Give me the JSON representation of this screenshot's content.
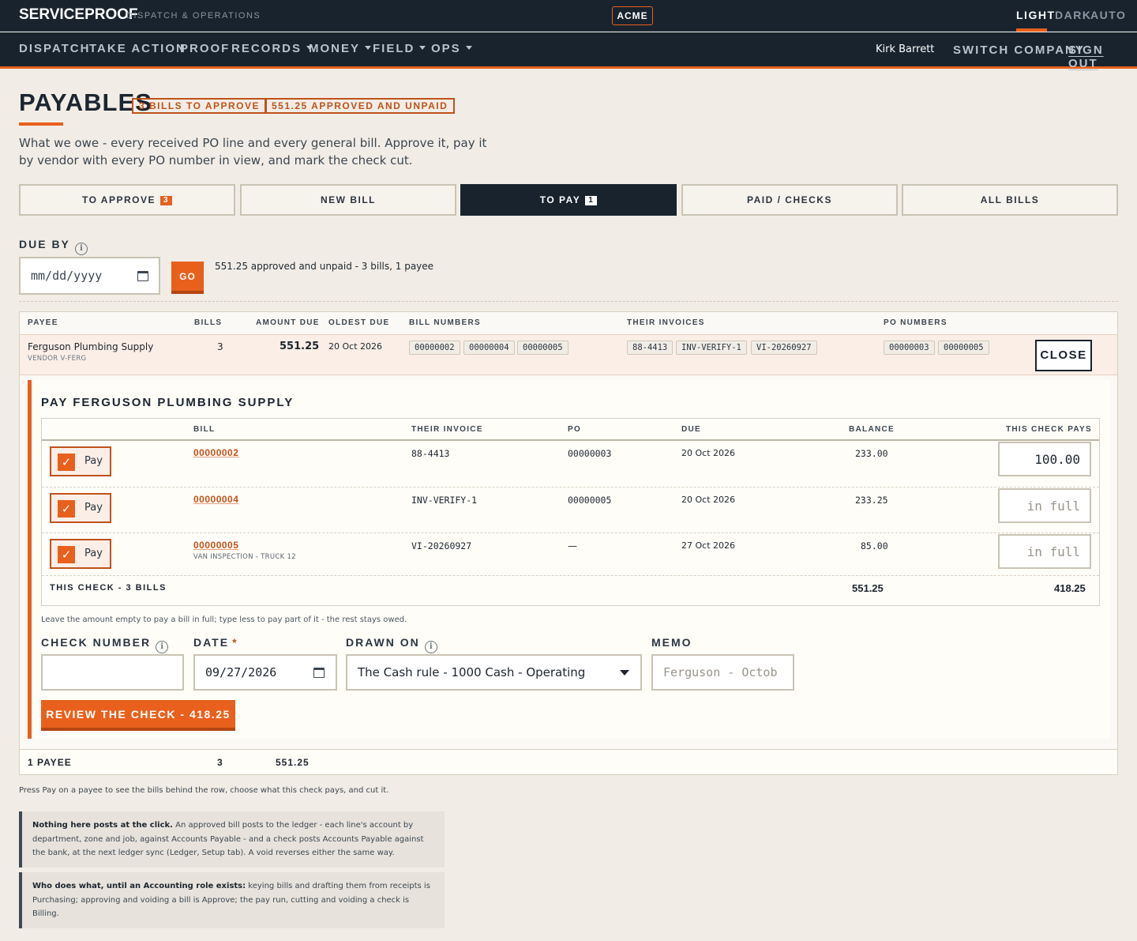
{
  "app": {
    "brand": "SERVICEPROOF",
    "brand_sub": "DISPATCH & OPERATIONS",
    "company_badge": "ACME",
    "theme": {
      "light": "LIGHT",
      "dark": "DARK",
      "auto": "AUTO",
      "selected": "LIGHT"
    }
  },
  "nav": {
    "items": [
      {
        "label": "DISPATCH"
      },
      {
        "label": "TAKE ACTION"
      },
      {
        "label": "PROOF"
      },
      {
        "label": "RECORDS"
      },
      {
        "label": "MONEY"
      },
      {
        "label": "FIELD"
      },
      {
        "label": "OPS"
      }
    ],
    "user": "Kirk Barrett",
    "switch_company": "SWITCH COMPANY",
    "sign_out": "SIGN OUT"
  },
  "page": {
    "title": "PAYABLES",
    "pill_approve": "3 BILLS TO APPROVE",
    "pill_unpaid": "551.25 APPROVED AND UNPAID",
    "lede": "What we owe - every received PO line and every general bill. Approve it, pay it by vendor with every PO number in view, and mark the check cut."
  },
  "tabs": [
    {
      "label": "TO APPROVE",
      "count": "3"
    },
    {
      "label": "NEW BILL",
      "count": ""
    },
    {
      "label": "TO PAY",
      "count": "1",
      "active": true
    },
    {
      "label": "PAID / CHECKS",
      "count": ""
    },
    {
      "label": "ALL BILLS",
      "count": ""
    }
  ],
  "filter": {
    "due_by_label": "DUE BY",
    "date_placeholder": "mm/dd/yyyy",
    "go": "GO",
    "summary": "551.25 approved and unpaid - 3 bills, 1 payee"
  },
  "payees": {
    "headers": {
      "payee": "PAYEE",
      "bills": "BILLS",
      "amount_due": "AMOUNT DUE",
      "oldest_due": "OLDEST DUE",
      "bill_numbers": "BILL NUMBERS",
      "their_invoices": "THEIR INVOICES",
      "po_numbers": "PO NUMBERS"
    },
    "row": {
      "name": "Ferguson Plumbing Supply",
      "vendor": "VENDOR V-FERG",
      "bills": "3",
      "amount_due": "551.25",
      "oldest_due": "20 Oct 2026",
      "bill_numbers": [
        "00000002",
        "00000004",
        "00000005"
      ],
      "their_invoices": [
        "88-4413",
        "INV-VERIFY-1",
        "VI-20260927"
      ],
      "po_numbers": [
        "00000003",
        "00000005"
      ],
      "close": "CLOSE"
    },
    "footer": {
      "label": "1 PAYEE",
      "bills": "3",
      "amount": "551.25"
    }
  },
  "pay": {
    "title": "PAY FERGUSON PLUMBING SUPPLY",
    "headers": {
      "bill": "BILL",
      "their_invoice": "THEIR INVOICE",
      "po": "PO",
      "due": "DUE",
      "balance": "BALANCE",
      "this_check_pays": "THIS CHECK PAYS"
    },
    "pay_label": "Pay",
    "lines": [
      {
        "bill": "00000002",
        "sub": "",
        "their_invoice": "88-4413",
        "po": "00000003",
        "due": "20 Oct 2026",
        "balance": "233.00",
        "pays_value": "100.00",
        "pays_placeholder": ""
      },
      {
        "bill": "00000004",
        "sub": "",
        "their_invoice": "INV-VERIFY-1",
        "po": "00000005",
        "due": "20 Oct 2026",
        "balance": "233.25",
        "pays_value": "",
        "pays_placeholder": "in full"
      },
      {
        "bill": "00000005",
        "sub": "VAN INSPECTION - TRUCK 12",
        "their_invoice": "VI-20260927",
        "po": "—",
        "due": "27 Oct 2026",
        "balance": "85.00",
        "pays_value": "",
        "pays_placeholder": "in full"
      }
    ],
    "total_label": "THIS CHECK - 3 BILLS",
    "total_balance": "551.25",
    "total_pays": "418.25",
    "help": "Leave the amount empty to pay a bill in full; type less to pay part of it - the rest stays owed.",
    "check_number_label": "CHECK NUMBER",
    "check_number_value": "",
    "date_label": "DATE",
    "date_required": "*",
    "date_value": "09/27/2026",
    "drawn_on_label": "DRAWN ON",
    "drawn_on_value": "The Cash rule - 1000 Cash - Operating",
    "memo_label": "MEMO",
    "memo_placeholder": "Ferguson - Octob",
    "review_button": "REVIEW THE CHECK - 418.25"
  },
  "notes": {
    "hint": "Press Pay on a payee to see the bills behind the row, choose what this check pays, and cut it.",
    "callout1_bold": "Nothing here posts at the click.",
    "callout1_text": " An approved bill posts to the ledger - each line's account by department, zone and job, against Accounts Payable - and a check posts Accounts Payable against the bank, at the next ledger sync (Ledger, Setup tab). A void reverses either the same way.",
    "callout2_bold": "Who does what, until an Accounting role exists:",
    "callout2_text": " keying bills and drafting them from receipts is Purchasing; approving and voiding a bill is Approve; the pay run, cutting and voiding a check is Billing."
  },
  "colors": {
    "accent": "#e8601c",
    "navy": "#18232e",
    "paper": "#f1ede6"
  }
}
